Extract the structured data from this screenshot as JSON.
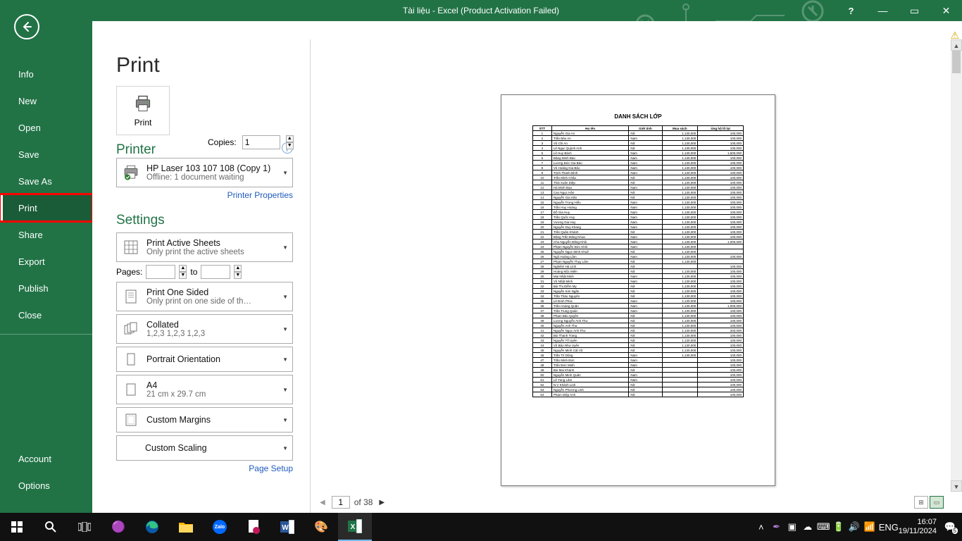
{
  "titlebar": {
    "title": "Tài liệu - Excel (Product Activation Failed)",
    "help": "?",
    "minimize": "—",
    "restore": "▭",
    "close": "✕"
  },
  "nav": {
    "info": "Info",
    "new": "New",
    "open": "Open",
    "save": "Save",
    "save_as": "Save As",
    "print": "Print",
    "share": "Share",
    "export": "Export",
    "publish": "Publish",
    "close": "Close",
    "account": "Account",
    "options": "Options"
  },
  "print": {
    "heading": "Print",
    "button_label": "Print",
    "copies_label": "Copies:",
    "copies_value": "1",
    "printer_heading": "Printer",
    "printer_name": "HP Laser 103 107 108 (Copy 1)",
    "printer_status": "Offline: 1 document waiting",
    "printer_properties": "Printer Properties",
    "settings_heading": "Settings",
    "setting_what": {
      "l1": "Print Active Sheets",
      "l2": "Only print the active sheets"
    },
    "pages_label": "Pages:",
    "pages_to": "to",
    "setting_sided": {
      "l1": "Print One Sided",
      "l2": "Only print on one side of th…"
    },
    "setting_collate": {
      "l1": "Collated",
      "l2": "1,2,3    1,2,3    1,2,3"
    },
    "setting_orient": {
      "l1": "Portrait Orientation"
    },
    "setting_paper": {
      "l1": "A4",
      "l2": "21 cm x 29.7 cm"
    },
    "setting_margins": {
      "l1": "Custom Margins"
    },
    "setting_scale": {
      "l1": "Custom Scaling"
    },
    "page_setup": "Page Setup"
  },
  "preview": {
    "current_page": "1",
    "of_label": "of 38",
    "doc_title": "DANH SÁCH LỚP",
    "headers": [
      "STT",
      "Họ tên",
      "Giới tính",
      "Mua sách",
      "Ủng hộ lũ lụt"
    ],
    "rows": [
      [
        "1",
        "Nguyễn Gia An",
        "Nữ",
        "1,130,000",
        "100,000"
      ],
      [
        "2",
        "Trần Bảo An",
        "Nam",
        "1,130,000",
        "100,000"
      ],
      [
        "3",
        "Vũ Chi An",
        "Nữ",
        "1,130,000",
        "100,000"
      ],
      [
        "4",
        "Lê Ngọc Quỳnh Anh",
        "Nữ",
        "1,130,000",
        "100,000"
      ],
      [
        "5",
        "Lê Huy Bách",
        "Nam",
        "1,130,000",
        "1,500,000"
      ],
      [
        "6",
        "Đặng Minh Bảo",
        "Nam",
        "1,130,000",
        "100,000"
      ],
      [
        "7",
        "Lương Đức Gia Bảo",
        "Nam",
        "1,130,000",
        "100,000"
      ],
      [
        "8",
        "Vũ Hoàng Gia Bảo",
        "Nam",
        "1,130,000",
        "100,000"
      ],
      [
        "9",
        "Trịnh Thanh Bình",
        "Nam",
        "1,130,000",
        "100,000"
      ],
      [
        "10",
        "Trần Minh Châu",
        "Nữ",
        "1,130,000",
        "100,000"
      ],
      [
        "11",
        "Thái Xuân Diệp",
        "Nữ",
        "1,130,000",
        "100,000"
      ],
      [
        "12",
        "Hà Minh Đạo",
        "Nam",
        "1,130,000",
        "100,000"
      ],
      [
        "13",
        "Cao Ngọc Hân",
        "Nữ",
        "1,130,000",
        "100,000"
      ],
      [
        "14",
        "Nguyễn Gia Hân",
        "Nữ",
        "1,130,000",
        "100,000"
      ],
      [
        "15",
        "Nguyễn Trung Hiếu",
        "Nam",
        "1,130,000",
        "100,000"
      ],
      [
        "16",
        "Trần Huy Hoàng",
        "Nam",
        "1,130,000",
        "100,000"
      ],
      [
        "17",
        "Đỗ Gia Huy",
        "Nam",
        "1,130,000",
        "100,000"
      ],
      [
        "18",
        "Trần Quốc Huy",
        "Nam",
        "1,130,000",
        "100,000"
      ],
      [
        "19",
        "Vương Gia Huy",
        "Nam",
        "1,130,000",
        "100,000"
      ],
      [
        "20",
        "Nguyễn Duy Khang",
        "Nam",
        "1,130,000",
        "100,000"
      ],
      [
        "21",
        "Trần Quân Khánh",
        "Nữ",
        "1,130,000",
        "100,000"
      ],
      [
        "22",
        "Đặng Trần Đăng Khoa",
        "Nam",
        "1,130,000",
        "100,000"
      ],
      [
        "23",
        "Chu Nguyễn Đăng Khôi",
        "Nam",
        "1,130,000",
        "1,000,000"
      ],
      [
        "24",
        "Phạm Nguyễn Đức Khôi",
        "Nam",
        "1,130,000",
        ""
      ],
      [
        "25",
        "Nguyễn Ngọc Minh Khuê",
        "Nữ",
        "1,130,000",
        ""
      ],
      [
        "26",
        "Ngô Hoàng Lâm",
        "Nam",
        "1,130,000",
        "100,000"
      ],
      [
        "27",
        "Phạm Nguyễn Thụy Lâm",
        "Nữ",
        "1,130,000",
        ""
      ],
      [
        "28",
        "Nghiêm Hà Linh",
        "Nữ",
        "",
        "100,000"
      ],
      [
        "29",
        "Hoàng Mộc Miên",
        "Nữ",
        "1,130,000",
        "100,000"
      ],
      [
        "30",
        "Mai Nhật Minh",
        "Nam",
        "1,130,000",
        "100,000"
      ],
      [
        "31",
        "Vũ Nhật Minh",
        "Nam",
        "1,130,000",
        "100,000"
      ],
      [
        "32",
        "Bùi Thị Diễm My",
        "Nữ",
        "1,130,000",
        "100,000"
      ],
      [
        "33",
        "Nguyễn Kim Ngân",
        "Nữ",
        "1,130,000",
        "100,000"
      ],
      [
        "34",
        "Trần Thảo Nguyên",
        "Nữ",
        "1,130,000",
        "100,000"
      ],
      [
        "35",
        "Lê Đình Phúc",
        "Nam",
        "1,130,000",
        "100,000"
      ],
      [
        "36",
        "Trần Hoàng Quân",
        "Nam",
        "1,130,000",
        "1,000,000"
      ],
      [
        "37",
        "Trần Trung Quân",
        "Nam",
        "1,130,000",
        "100,000"
      ],
      [
        "38",
        "Phạm Bảo Quyên",
        "Nữ",
        "1,130,000",
        "100,000"
      ],
      [
        "39",
        "Lương Nguyễn Anh Thư",
        "Nữ",
        "1,130,000",
        "100,000"
      ],
      [
        "40",
        "Nguyễn Anh Thư",
        "Nữ",
        "1,130,000",
        "100,000"
      ],
      [
        "41",
        "Nguyễn Ngọc Anh Thư",
        "Nữ",
        "1,130,000",
        "200,000"
      ],
      [
        "42",
        "Bùi Thanh Trang",
        "Nữ",
        "1,130,000",
        "100,000"
      ],
      [
        "43",
        "Nguyễn Tố Uyên",
        "Nữ",
        "1,130,000",
        "100,000"
      ],
      [
        "44",
        "Vũ Bảo Như Uyên",
        "Nữ",
        "1,130,000",
        "100,000"
      ],
      [
        "45",
        "Nguyễn Minh Cát Vũ",
        "Nữ",
        "1,130,000",
        "100,000"
      ],
      [
        "46",
        "Trần Trí Dũng",
        "Nam",
        "1,130,000",
        "100,000"
      ],
      [
        "47",
        "Trần Minh Đức",
        "Nam",
        "",
        "100,000"
      ],
      [
        "48",
        "Trần Đức Minh",
        "Nam",
        "",
        "100,000"
      ],
      [
        "49",
        "Bùi Mai Khánh",
        "Nữ",
        "",
        "100,000"
      ],
      [
        "50",
        "Nguyễn Minh Quân",
        "Nam",
        "",
        "100,000"
      ],
      [
        "51",
        "Lê Tùng Lâm",
        "Nam",
        "",
        "100,000"
      ],
      [
        "52",
        "N.V Khánh Linh",
        "Nữ",
        "",
        "100,000"
      ],
      [
        "53",
        "Nguyễn Phương Linh",
        "Nữ",
        "",
        "100,000"
      ],
      [
        "54",
        "Phạm Diệp Anh",
        "Nữ",
        "",
        "100,000"
      ]
    ]
  },
  "taskbar": {
    "lang": "ENG",
    "time": "16:07",
    "date": "19/11/2024",
    "notif": "5"
  }
}
